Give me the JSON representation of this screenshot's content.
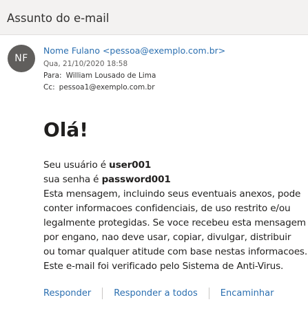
{
  "header": {
    "subject": "Assunto do e-mail"
  },
  "message": {
    "avatar_initials": "NF",
    "sender": "Nome Fulano <pessoa@exemplo.com.br>",
    "date": "Qua, 21/10/2020 18:58",
    "to_label": "Para:",
    "to_value": "William Lousado de Lima",
    "cc_label": "Cc:",
    "cc_value": "pessoa1@exemplo.com.br"
  },
  "body": {
    "greeting": "Olá!",
    "user_prefix": "Seu usuário é ",
    "user_value": "user001",
    "password_prefix": "sua senha é ",
    "password_value": "password001",
    "lines": [
      "Esta mensagem, incluindo seus eventuais anexos, pode",
      "conter informacoes confidenciais, de uso restrito e/ou",
      "legalmente protegidas. Se voce recebeu esta mensagem",
      "por engano, nao deve usar, copiar, divulgar, distribuir",
      "ou tomar qualquer atitude com base nestas informacoes.",
      "Este e-mail foi verificado pelo Sistema de Anti-Virus."
    ]
  },
  "actions": {
    "reply": "Responder",
    "reply_all": "Responder a todos",
    "forward": "Encaminhar"
  }
}
